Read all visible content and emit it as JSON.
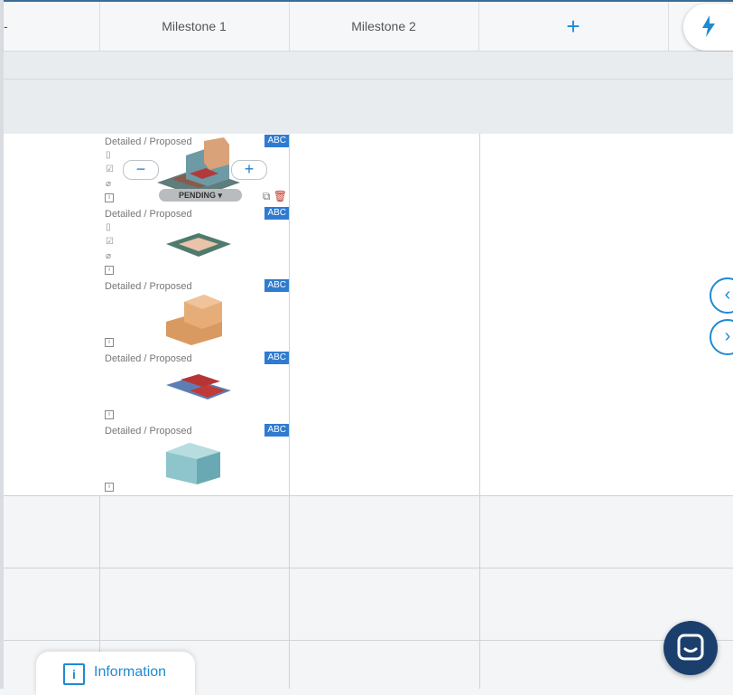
{
  "header": {
    "col0": "-",
    "col1": "Milestone 1",
    "col2": "Milestone 2",
    "add": "+"
  },
  "rows": [
    {
      "label": "Detailed / Proposed",
      "badge": "ABC"
    },
    {
      "label": "Detailed / Proposed",
      "badge": "ABC"
    },
    {
      "label": "Detailed / Proposed",
      "badge": "ABC"
    },
    {
      "label": "Detailed / Proposed",
      "badge": "ABC"
    },
    {
      "label": "Detailed / Proposed",
      "badge": "ABC"
    }
  ],
  "controls": {
    "zoom_out": "−",
    "zoom_in": "+",
    "status": "PENDING ▾"
  },
  "nav": {
    "prev": "‹",
    "next": "›"
  },
  "info_button": {
    "icon": "i",
    "label": "Information"
  },
  "colors": {
    "accent": "#1f8ad2",
    "badge": "#2f7bd1",
    "chat": "#1b3f6d"
  }
}
